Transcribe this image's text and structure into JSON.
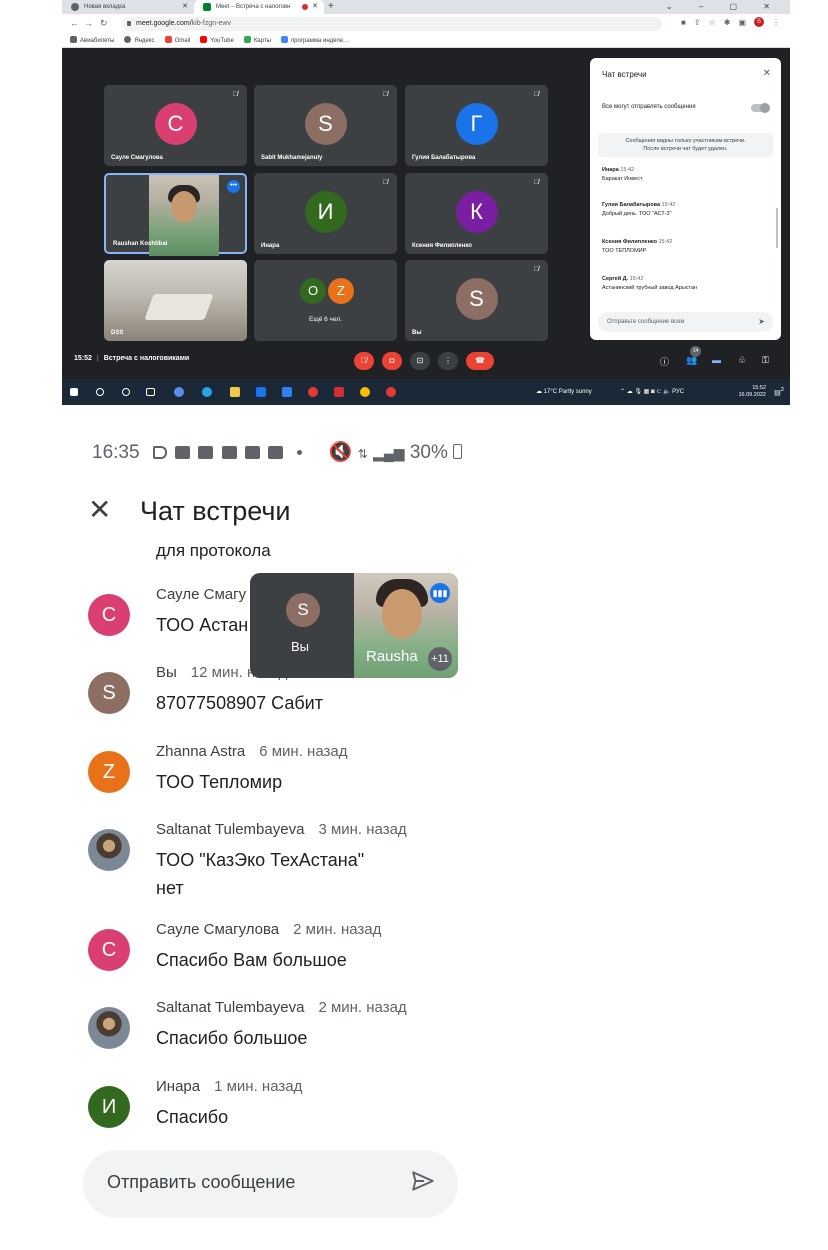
{
  "browser": {
    "tabs": [
      {
        "label": "Новая вкладка",
        "active": false
      },
      {
        "label": "Meet – Встреча с налоговн",
        "active": true
      }
    ],
    "url_host": "meet.google.com/",
    "url_path": "kib-fzgn-ewv",
    "bookmarks": [
      "Авиабилеты",
      "Яндекс",
      "Gmail",
      "YouTube",
      "Карты",
      "программа индепе..."
    ]
  },
  "meet": {
    "tiles": [
      {
        "name": "Сауле Смагулова",
        "initial": "С",
        "color": "#d93f71"
      },
      {
        "name": "Sabit Mukhamejanuly",
        "initial": "S",
        "color": "#8d6e63"
      },
      {
        "name": "Гулия Балабатырова",
        "initial": "Г",
        "color": "#1a73e8"
      },
      {
        "name": "Raushan Koshtibai",
        "initial": "",
        "color": ""
      },
      {
        "name": "Инара",
        "initial": "И",
        "color": "#33691e"
      },
      {
        "name": "Ксения Филипленко",
        "initial": "К",
        "color": "#7b1fa2"
      },
      {
        "name": "DSS",
        "initial": "",
        "color": ""
      },
      {
        "name": "Ещё 6 чел.",
        "initial": "",
        "color": ""
      },
      {
        "name": "Вы",
        "initial": "S",
        "color": "#8d6e63"
      }
    ],
    "more_initials": [
      "О",
      "Z"
    ],
    "time": "15:52",
    "meeting_title": "Встреча с налоговиками",
    "participants_count": "14",
    "chat": {
      "title": "Чат встречи",
      "toggle_label": "Все могут отправлять сообщения",
      "info_line1": "Сообщения видны только участникам встречи.",
      "info_line2": "После встречи чат будет удален.",
      "messages": [
        {
          "name": "Инара",
          "time": "15:42",
          "text": "Баракат Инвест"
        },
        {
          "name": "Гулия Балабатырова",
          "time": "15:42",
          "text": "Добрый день. ТОО \"АСТ-3\""
        },
        {
          "name": "Ксения Филипленко",
          "time": "15:42",
          "text": "ТОО ТЕПЛОМИР"
        },
        {
          "name": "Сергей Д.",
          "time": "15:42",
          "text": "Астанинский трубный завод Арыстан"
        }
      ],
      "input_placeholder": "Отправьте сообщение всем"
    }
  },
  "taskbar": {
    "weather": "17°C  Partly sunny",
    "lang": "РУС",
    "clock_time": "15:52",
    "clock_date": "16.09.2022",
    "notif": "2"
  },
  "phone": {
    "status_time": "16:35",
    "battery": "30%",
    "title": "Чат встречи",
    "cut_text": "для протокола",
    "pip": {
      "self_label": "Вы",
      "self_initial": "S",
      "other_name": "Rausha",
      "more": "+11"
    },
    "messages": [
      {
        "name": "Сауле Смагу",
        "time": "",
        "text": "ТОО Астан",
        "initial": "С",
        "color": "#d93f71",
        "lines": []
      },
      {
        "name": "Вы",
        "time": "12 мин. назад",
        "text": "87077508907 Сабит",
        "initial": "S",
        "color": "#8d6e63",
        "lines": []
      },
      {
        "name": "Zhanna Astra",
        "time": "6 мин. назад",
        "text": "ТОО Тепломир",
        "initial": "Z",
        "color": "#e8711a",
        "lines": []
      },
      {
        "name": "Saltanat Tulembayeva",
        "time": "3 мин. назад",
        "text": "ТОО \"КазЭко ТехАстана\"",
        "text2": "нет",
        "initial": "",
        "color": "photo"
      },
      {
        "name": "Сауле Смагулова",
        "time": "2 мин. назад",
        "text": "Спасибо Вам большое",
        "initial": "С",
        "color": "#d93f71"
      },
      {
        "name": "Saltanat Tulembayeva",
        "time": "2 мин. назад",
        "text": "Спасибо большое",
        "initial": "",
        "color": "photo"
      },
      {
        "name": "Инара",
        "time": "1 мин. назад",
        "text": "Спасибо",
        "initial": "И",
        "color": "#33691e"
      }
    ],
    "input_placeholder": "Отправить сообщение"
  }
}
